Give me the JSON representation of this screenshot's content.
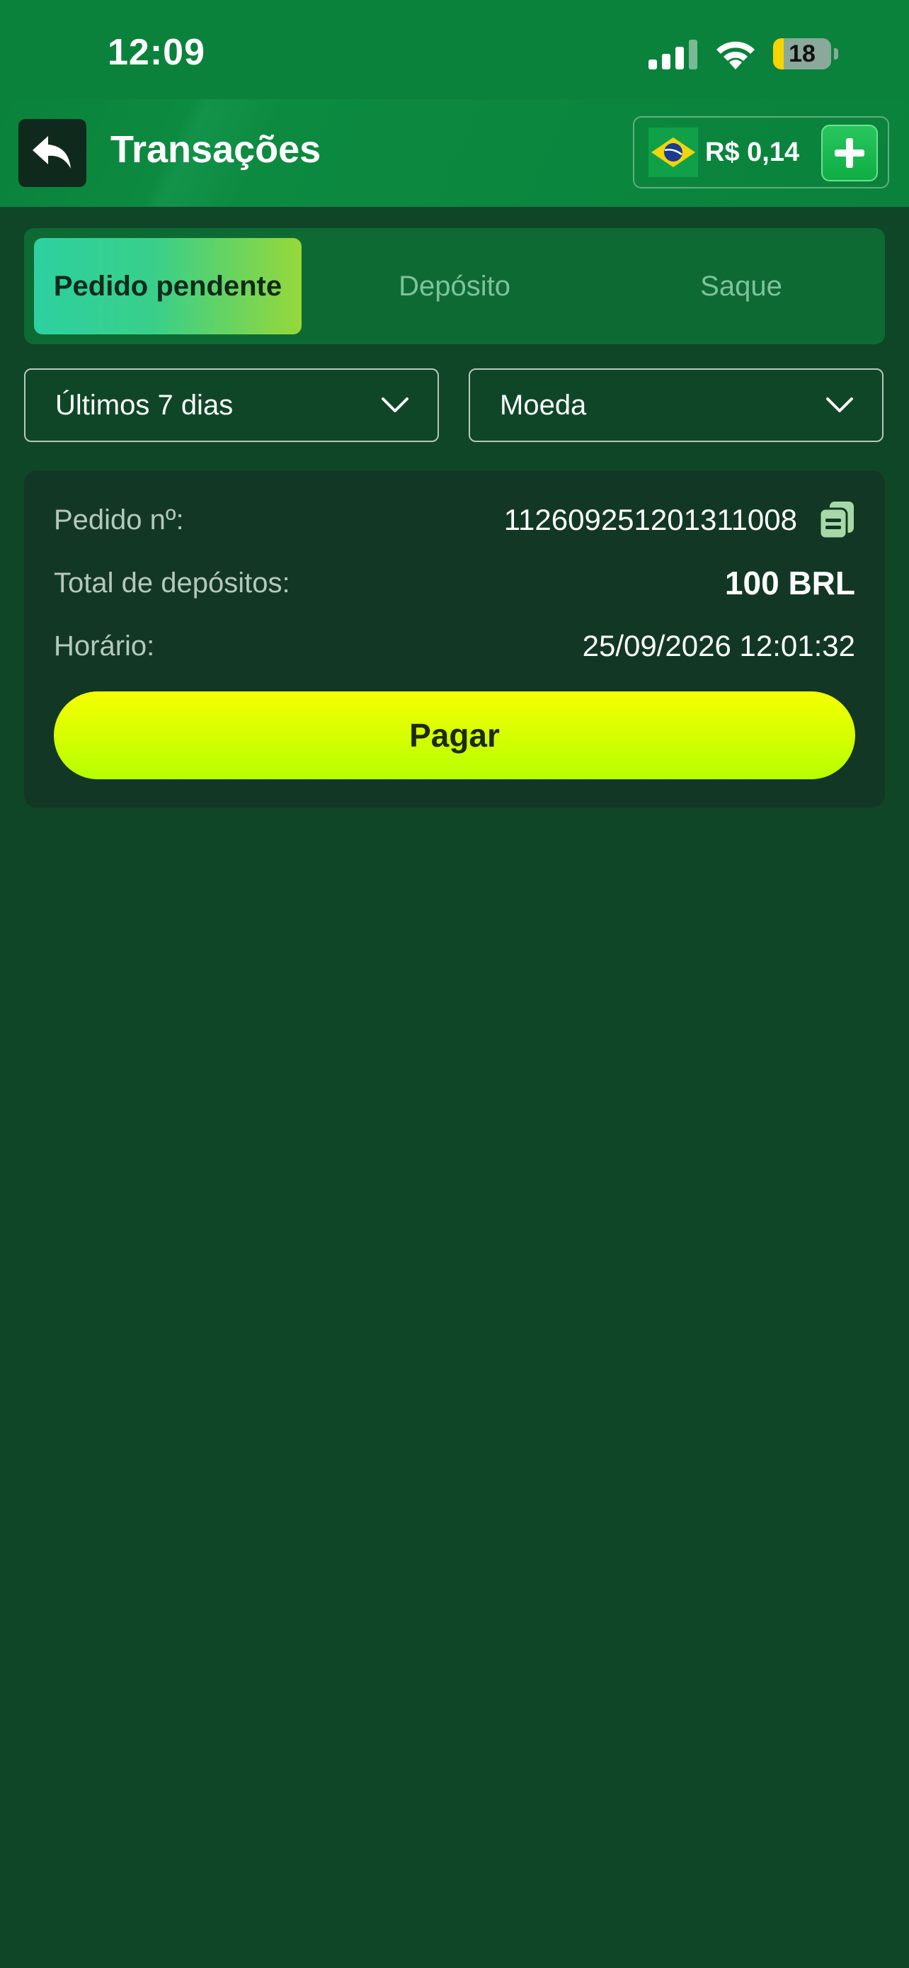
{
  "status_bar": {
    "time": "12:09",
    "battery": "18"
  },
  "header": {
    "title": "Transações",
    "balance": "R$ 0,14"
  },
  "tabs": [
    {
      "label": "Pedido pendente",
      "active": true
    },
    {
      "label": "Depósito",
      "active": false
    },
    {
      "label": "Saque",
      "active": false
    }
  ],
  "filters": {
    "period": "Últimos 7 dias",
    "currency": "Moeda"
  },
  "order": {
    "number_label": "Pedido nº:",
    "number": "112609251201311008",
    "total_label": "Total de depósitos:",
    "total": "100 BRL",
    "time_label": "Horário:",
    "time": "25/09/2026 12:01:32",
    "pay_label": "Pagar"
  },
  "colors": {
    "header_green": "#0a823b",
    "background": "#0f4627",
    "pay_button": "#dfff00"
  }
}
